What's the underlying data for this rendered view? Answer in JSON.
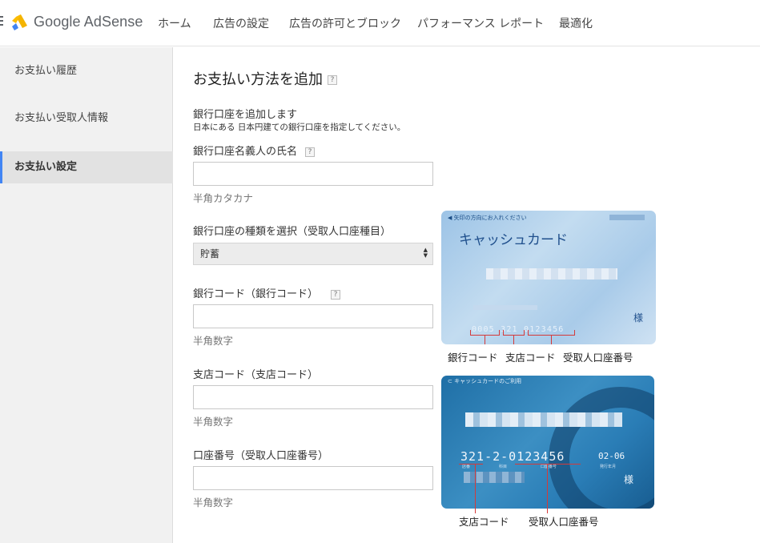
{
  "header": {
    "brand": "Google AdSense",
    "nav": [
      "ホーム",
      "広告の設定",
      "広告の許可とブロック",
      "パフォーマンス レポート",
      "最適化"
    ]
  },
  "sidebar": {
    "items": [
      {
        "label": "お支払い履歴"
      },
      {
        "label": "お支払い受取人情報"
      },
      {
        "label": "お支払い設定"
      }
    ]
  },
  "main": {
    "title": "お支払い方法を追加",
    "help_mark": "?",
    "section_heading": "銀行口座を追加します",
    "section_note": "日本にある 日本円建ての銀行口座を指定してください。",
    "fields": {
      "holder_name": {
        "label": "銀行口座名義人の氏名",
        "value": "",
        "hint": "半角カタカナ"
      },
      "account_type": {
        "label": "銀行口座の種類を選択（受取人口座種目）",
        "selected": "貯蓄"
      },
      "bank_code": {
        "label": "銀行コード（銀行コード）",
        "value": "",
        "hint": "半角数字"
      },
      "branch_code": {
        "label": "支店コード（支店コード）",
        "value": "",
        "hint": "半角数字"
      },
      "account_number": {
        "label": "口座番号（受取人口座番号）",
        "value": "",
        "hint": "半角数字"
      }
    }
  },
  "cards": {
    "card1": {
      "top_text": "矢印の方向にお入れください",
      "name": "キャッシュカード",
      "sama": "様",
      "numbers": "0005 321 0123456",
      "captions": [
        "銀行コード",
        "支店コード",
        "受取人口座番号"
      ]
    },
    "card2": {
      "top_text": "キャッシュカードのご利用",
      "numbers": "321-2-0123456",
      "expiry": "02-06",
      "small_labels": [
        "店番",
        "科目",
        "口座番号",
        "発行年月"
      ],
      "sama": "様",
      "captions": [
        "支店コード",
        "受取人口座番号"
      ]
    }
  },
  "colors": {
    "accent": "#4285f4",
    "annotation": "#d43a3a"
  }
}
